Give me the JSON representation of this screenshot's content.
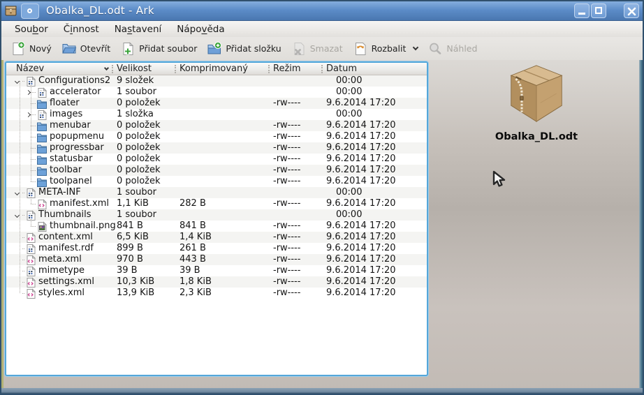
{
  "window": {
    "title": "Obalka_DL.odt - Ark"
  },
  "titlebar": {
    "app_icon": "ark-box-icon",
    "buttons": [
      {
        "name": "window-menu-button",
        "icon": "circle-icon"
      },
      {
        "name": "minimize-button",
        "icon": "minimize-icon"
      },
      {
        "name": "maximize-button",
        "icon": "maximize-icon"
      },
      {
        "name": "close-button",
        "icon": "close-icon"
      }
    ]
  },
  "menubar": {
    "items": [
      {
        "label": "Soubor",
        "pre": "Sou",
        "key": "b",
        "post": "or"
      },
      {
        "label": "Činnost",
        "pre": "Č",
        "key": "i",
        "post": "nnost"
      },
      {
        "label": "Nastavení",
        "pre": "Na",
        "key": "s",
        "post": "tavení"
      },
      {
        "label": "Nápověda",
        "pre": "Nápo",
        "key": "v",
        "post": "ěda"
      }
    ]
  },
  "toolbar": {
    "buttons": [
      {
        "label": "Nový",
        "icon": "new-archive-icon",
        "enabled": true,
        "has_dropdown": false
      },
      {
        "label": "Otevřít",
        "icon": "open-folder-icon",
        "enabled": true,
        "has_dropdown": false
      },
      {
        "label": "Přidat soubor",
        "icon": "add-file-icon",
        "enabled": true,
        "has_dropdown": false
      },
      {
        "label": "Přidat složku",
        "icon": "add-folder-icon",
        "enabled": true,
        "has_dropdown": false
      },
      {
        "label": "Smazat",
        "icon": "delete-icon",
        "enabled": false,
        "has_dropdown": false
      },
      {
        "label": "Rozbalit",
        "icon": "extract-icon",
        "enabled": true,
        "has_dropdown": true
      },
      {
        "label": "Náhled",
        "icon": "preview-icon",
        "enabled": false,
        "has_dropdown": false
      }
    ]
  },
  "filelist": {
    "columns": [
      "Název",
      "Velikost",
      "Komprimovaný",
      "Režim",
      "Datum"
    ],
    "sort_column": "Název",
    "sort_direction": "down",
    "rows": [
      {
        "name": "Configurations2",
        "depth": 0,
        "icon": "binary-file-icon",
        "expander": "expanded",
        "size": "9 složek",
        "compressed": "",
        "mode": "",
        "date": "00:00"
      },
      {
        "name": "accelerator",
        "depth": 1,
        "icon": "binary-file-icon",
        "expander": "collapsed",
        "size": "1 soubor",
        "compressed": "",
        "mode": "",
        "date": "00:00"
      },
      {
        "name": "floater",
        "depth": 1,
        "icon": "folder-icon",
        "expander": null,
        "size": "0 položek",
        "compressed": "",
        "mode": "-rw----",
        "date": "9.6.2014 17:20"
      },
      {
        "name": "images",
        "depth": 1,
        "icon": "binary-file-icon",
        "expander": "collapsed",
        "size": "1 složka",
        "compressed": "",
        "mode": "",
        "date": "00:00"
      },
      {
        "name": "menubar",
        "depth": 1,
        "icon": "folder-icon",
        "expander": null,
        "size": "0 položek",
        "compressed": "",
        "mode": "-rw----",
        "date": "9.6.2014 17:20"
      },
      {
        "name": "popupmenu",
        "depth": 1,
        "icon": "folder-icon",
        "expander": null,
        "size": "0 položek",
        "compressed": "",
        "mode": "-rw----",
        "date": "9.6.2014 17:20"
      },
      {
        "name": "progressbar",
        "depth": 1,
        "icon": "folder-icon",
        "expander": null,
        "size": "0 položek",
        "compressed": "",
        "mode": "-rw----",
        "date": "9.6.2014 17:20"
      },
      {
        "name": "statusbar",
        "depth": 1,
        "icon": "folder-icon",
        "expander": null,
        "size": "0 položek",
        "compressed": "",
        "mode": "-rw----",
        "date": "9.6.2014 17:20"
      },
      {
        "name": "toolbar",
        "depth": 1,
        "icon": "folder-icon",
        "expander": null,
        "size": "0 položek",
        "compressed": "",
        "mode": "-rw----",
        "date": "9.6.2014 17:20"
      },
      {
        "name": "toolpanel",
        "depth": 1,
        "icon": "folder-icon",
        "expander": null,
        "size": "0 položek",
        "compressed": "",
        "mode": "-rw----",
        "date": "9.6.2014 17:20"
      },
      {
        "name": "META-INF",
        "depth": 0,
        "icon": "binary-file-icon",
        "expander": "expanded",
        "size": "1 soubor",
        "compressed": "",
        "mode": "",
        "date": "00:00"
      },
      {
        "name": "manifest.xml",
        "depth": 1,
        "icon": "xml-file-icon",
        "expander": null,
        "size": "1,1 KiB",
        "compressed": "282 B",
        "mode": "-rw----",
        "date": "9.6.2014 17:20"
      },
      {
        "name": "Thumbnails",
        "depth": 0,
        "icon": "binary-file-icon",
        "expander": "expanded",
        "size": "1 soubor",
        "compressed": "",
        "mode": "",
        "date": "00:00"
      },
      {
        "name": "thumbnail.png",
        "depth": 1,
        "icon": "image-file-icon",
        "expander": null,
        "size": "841 B",
        "compressed": "841 B",
        "mode": "-rw----",
        "date": "9.6.2014 17:20"
      },
      {
        "name": "content.xml",
        "depth": 0,
        "icon": "xml-file-icon",
        "expander": null,
        "size": "6,5 KiB",
        "compressed": "1,4 KiB",
        "mode": "-rw----",
        "date": "9.6.2014 17:20"
      },
      {
        "name": "manifest.rdf",
        "depth": 0,
        "icon": "binary-file-icon",
        "expander": null,
        "size": "899 B",
        "compressed": "261 B",
        "mode": "-rw----",
        "date": "9.6.2014 17:20"
      },
      {
        "name": "meta.xml",
        "depth": 0,
        "icon": "xml-file-icon",
        "expander": null,
        "size": "970 B",
        "compressed": "443 B",
        "mode": "-rw----",
        "date": "9.6.2014 17:20"
      },
      {
        "name": "mimetype",
        "depth": 0,
        "icon": "binary-file-icon",
        "expander": null,
        "size": "39 B",
        "compressed": "39 B",
        "mode": "-rw----",
        "date": "9.6.2014 17:20"
      },
      {
        "name": "settings.xml",
        "depth": 0,
        "icon": "xml-file-icon",
        "expander": null,
        "size": "10,3 KiB",
        "compressed": "1,8 KiB",
        "mode": "-rw----",
        "date": "9.6.2014 17:20"
      },
      {
        "name": "styles.xml",
        "depth": 0,
        "icon": "xml-file-icon",
        "expander": null,
        "size": "13,9 KiB",
        "compressed": "2,3 KiB",
        "mode": "-rw----",
        "date": "9.6.2014 17:20"
      }
    ]
  },
  "info_panel": {
    "file_name": "Obalka_DL.odt",
    "icon": "archive-box-icon"
  },
  "colors": {
    "titlebar_blue": "#5c8cc8",
    "focus_border_blue": "#54a7da",
    "window_background": "#c3bcb6",
    "disabled_text": "#a9a7a2",
    "folder_blue": "#6da1d8",
    "xml_pink": "#cc3f8f",
    "box_tan": "#c5a372"
  }
}
